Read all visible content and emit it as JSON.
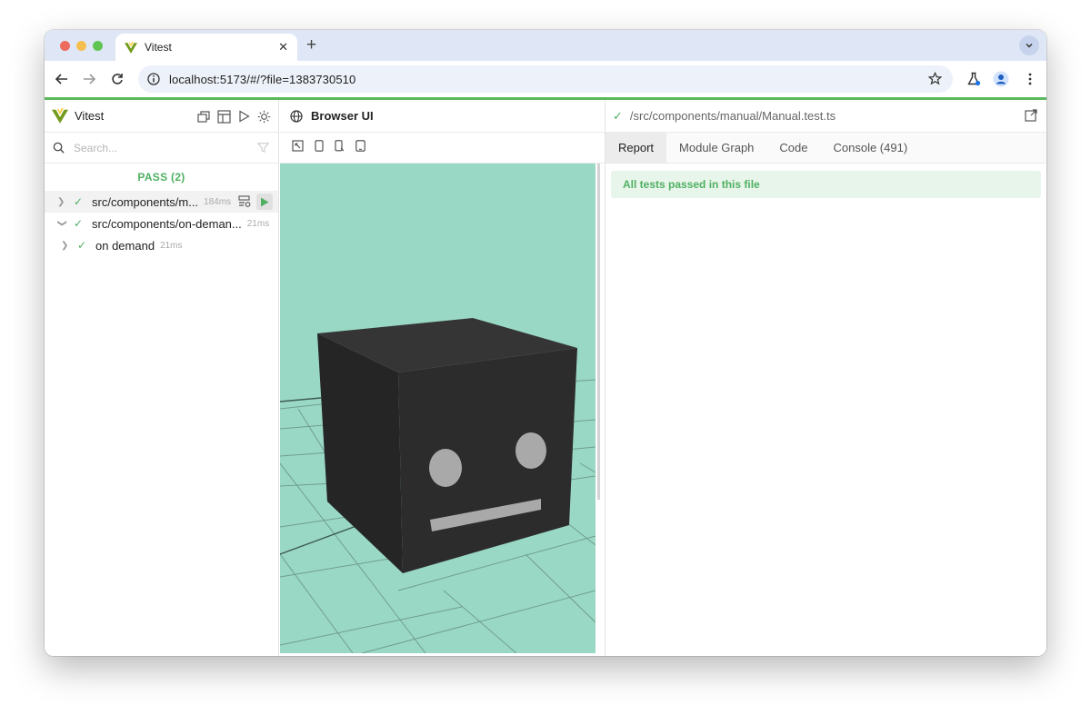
{
  "browser": {
    "tab_title": "Vitest",
    "url": "localhost:5173/#/?file=1383730510"
  },
  "sidebar": {
    "app_name": "Vitest",
    "search_placeholder": "Search...",
    "pass_label": "PASS (2)",
    "files": [
      {
        "name": "src/components/m...",
        "duration": "184ms"
      },
      {
        "name": "src/components/on-deman...",
        "duration": "21ms"
      },
      {
        "name": "on demand",
        "duration": "21ms"
      }
    ]
  },
  "browser_pane": {
    "title": "Browser UI"
  },
  "report": {
    "file_path": "/src/components/manual/Manual.test.ts",
    "tabs": [
      "Report",
      "Module Graph",
      "Code",
      "Console (491)"
    ],
    "active_tab": "Report",
    "status_message": "All tests passed in this file"
  },
  "colors": {
    "pass_green": "#4fb062",
    "viewport_bg": "#9ad8c6",
    "cube": "#2a2a2a",
    "accent_bar": "#5bb85d"
  }
}
